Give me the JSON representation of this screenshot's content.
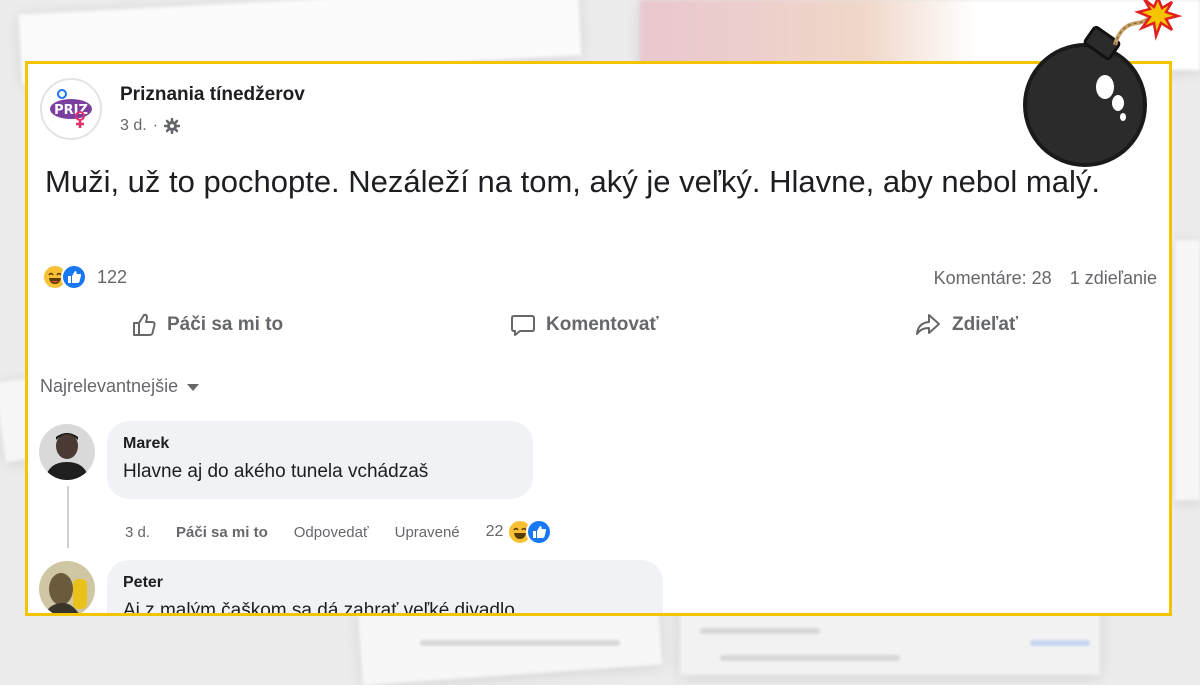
{
  "post": {
    "page_name": "Priznania tínedžerov",
    "time": "3 d.",
    "separator": "·",
    "more": "•••",
    "text": "Muži, už to pochopte. Nezáleží na tom, aký je veľký. Hlavne, aby nebol malý.",
    "reaction_count": "122",
    "comments_count": "Komentáre: 28",
    "shares_count": "1 zdieľanie"
  },
  "actions": {
    "like": "Páči sa mi to",
    "comment": "Komentovať",
    "share": "Zdieľať"
  },
  "sort_label": "Najrelevantnejšie",
  "comments": [
    {
      "author": "Marek",
      "text": "Hlavne aj do akého tunela vchádzaš",
      "time": "3 d.",
      "like": "Páči sa mi to",
      "reply": "Odpovedať",
      "edited": "Upravené",
      "reactions": "22"
    },
    {
      "author": "Peter",
      "text": "Aj z malým čaškom sa dá zahrať veľké divadlo"
    }
  ],
  "colors": {
    "frame": "#f5c400",
    "like_blue": "#1877f2",
    "haha_yellow": "#f7c035",
    "bubble": "#f0f2f5",
    "secondary_text": "#65676b"
  },
  "icons": {
    "settings": "gear-icon",
    "like": "thumbs-up-icon",
    "comment": "speech-bubble-icon",
    "share": "share-arrow-icon",
    "sort": "caret-down-icon",
    "decoration": "bomb-icon"
  }
}
